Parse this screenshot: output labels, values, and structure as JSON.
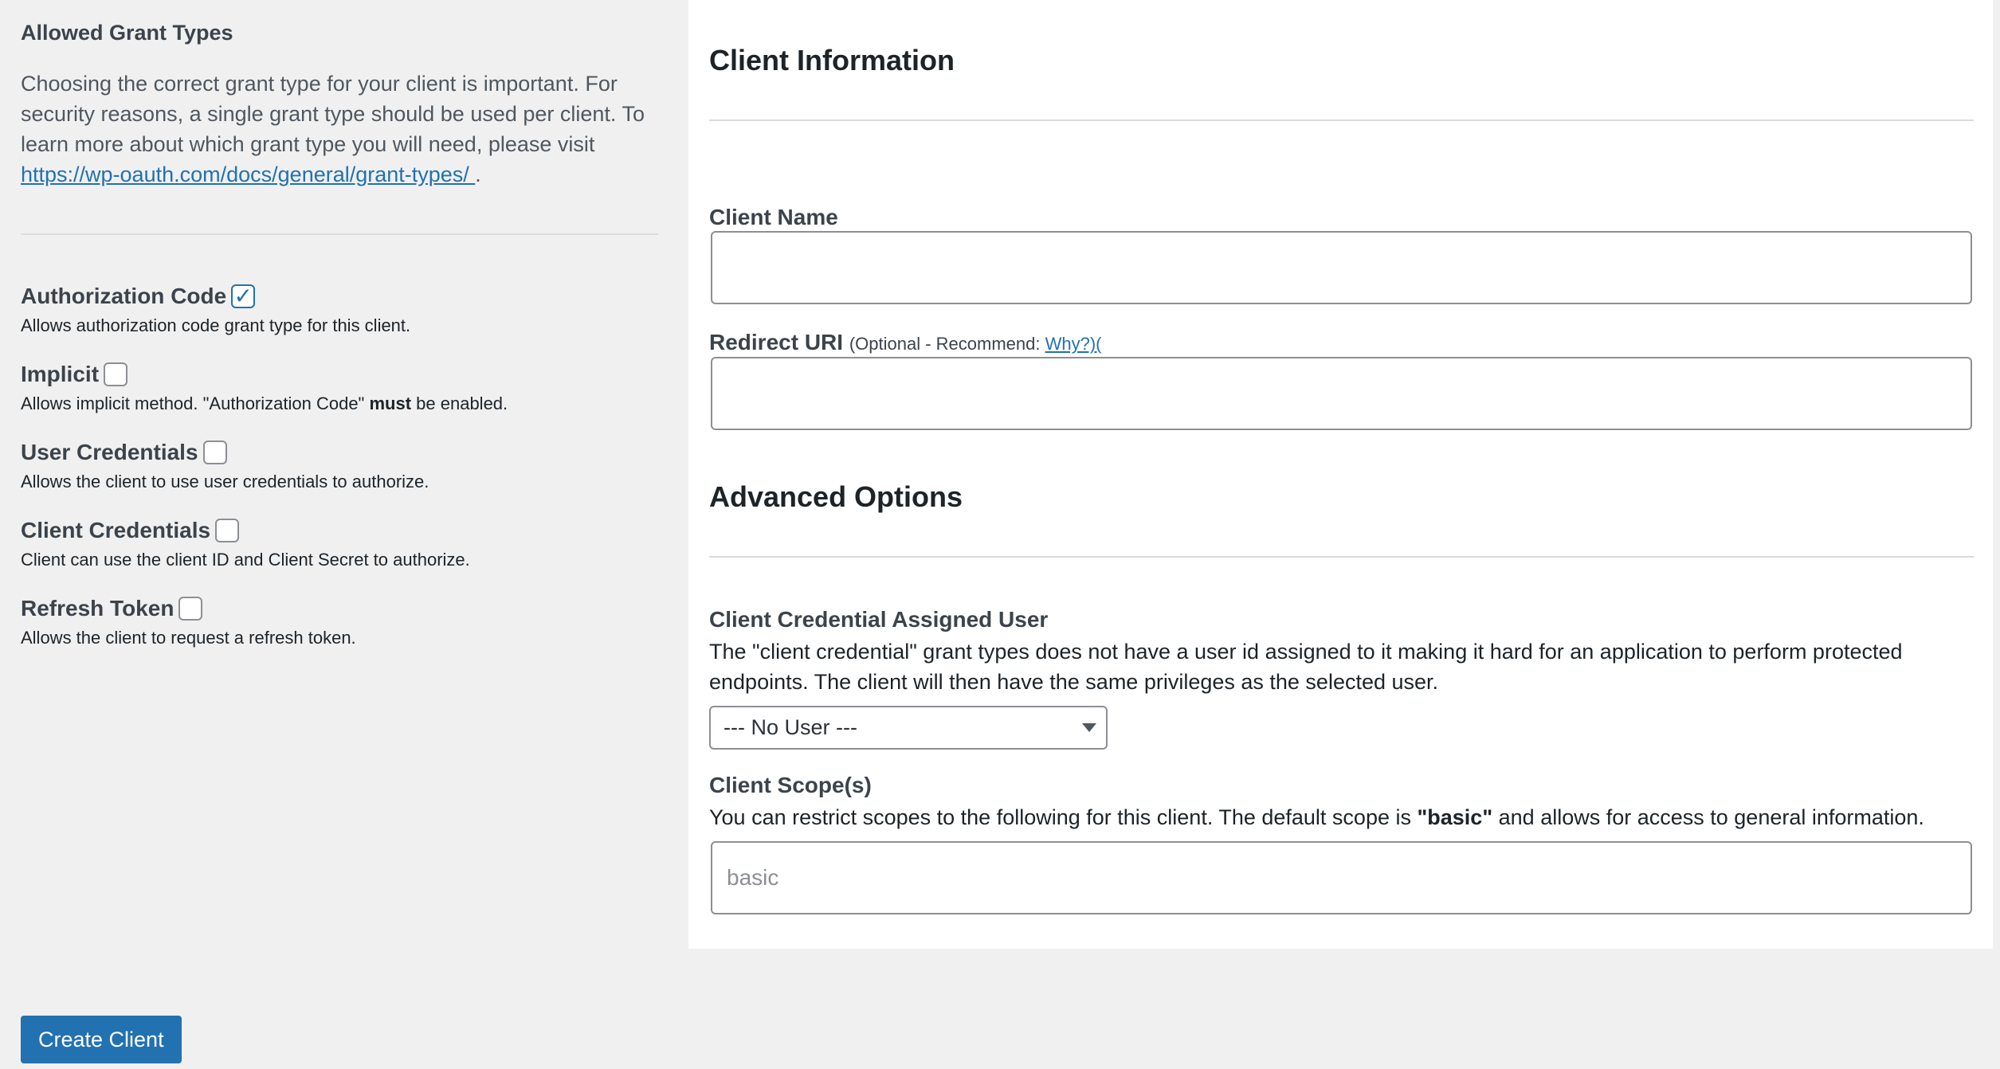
{
  "grant_types": {
    "title": "Allowed Grant Types",
    "intro_text": "Choosing the correct grant type for your client is important. For security reasons, a single grant type should be used per client. To learn more about which grant type you will need, please visit",
    "intro_link": "https://wp-oauth.com/docs/general/grant-types/ ",
    "intro_end": ".",
    "items": [
      {
        "label": "Authorization Code",
        "checked": true,
        "desc": "Allows authorization code grant type for this client."
      },
      {
        "label": "Implicit",
        "checked": false,
        "desc_pre": "Allows implicit method. \"Authorization Code\" ",
        "desc_bold": "must",
        "desc_post": " be enabled."
      },
      {
        "label": "User Credentials",
        "checked": false,
        "desc": "Allows the client to use user credentials to authorize."
      },
      {
        "label": "Client Credentials",
        "checked": false,
        "desc": "Client can use the client ID and Client Secret to authorize."
      },
      {
        "label": "Refresh Token",
        "checked": false,
        "desc": "Allows the client to request a refresh token."
      }
    ]
  },
  "client_info": {
    "title": "Client Information",
    "client_name_label": "Client Name",
    "client_name_value": "",
    "redirect_label": "Redirect URI",
    "redirect_note": "(Optional - Recommend: ",
    "redirect_link": "Why?)(",
    "redirect_value": ""
  },
  "advanced": {
    "title": "Advanced Options",
    "assigned_user_label": "Client Credential Assigned User",
    "assigned_user_desc": "The \"client credential\" grant types does not have a user id assigned to it making it hard for an application to perform protected endpoints. The client will then have the same privileges as the selected user.",
    "assigned_user_selected": "--- No User ---",
    "scope_label": "Client Scope(s)",
    "scope_desc_pre": "You can restrict scopes to the following for this client. The default scope is ",
    "scope_desc_bold": "\"basic\"",
    "scope_desc_post": " and allows for access to general information.",
    "scope_placeholder": "basic"
  },
  "actions": {
    "create_label": "Create Client"
  },
  "colors": {
    "accent": "#2271b1",
    "background": "#f0f0f1",
    "panel": "#ffffff"
  }
}
